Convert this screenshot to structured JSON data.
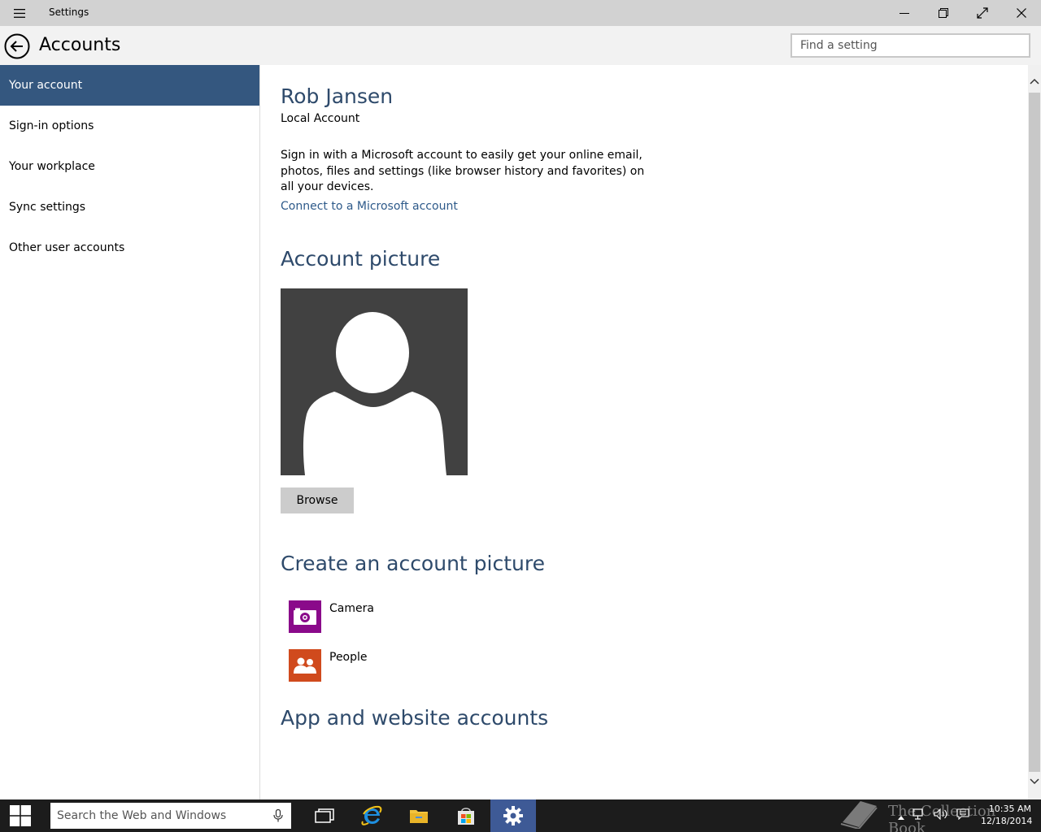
{
  "window": {
    "title": "Settings"
  },
  "header": {
    "title": "Accounts",
    "search_placeholder": "Find a setting"
  },
  "sidebar": {
    "items": [
      {
        "label": "Your account",
        "active": true
      },
      {
        "label": "Sign-in options",
        "active": false
      },
      {
        "label": "Your workplace",
        "active": false
      },
      {
        "label": "Sync settings",
        "active": false
      },
      {
        "label": "Other user accounts",
        "active": false
      }
    ]
  },
  "main": {
    "user_name": "Rob Jansen",
    "account_type": "Local Account",
    "description": "Sign in with a Microsoft account to easily get your online email, photos, files and settings (like browser history and favorites) on all your devices.",
    "connect_link": "Connect to a Microsoft account",
    "picture_heading": "Account picture",
    "browse_label": "Browse",
    "create_heading": "Create an account picture",
    "apps": [
      {
        "label": "Camera",
        "icon": "camera-icon",
        "color": "#8a0a8a"
      },
      {
        "label": "People",
        "icon": "people-icon",
        "color": "#d04a1d"
      }
    ],
    "app_accounts_heading": "App and website accounts"
  },
  "taskbar": {
    "search_placeholder": "Search the Web and Windows",
    "watermark": "The Collection Book",
    "clock_time": "10:35 AM",
    "clock_date": "12/18/2014",
    "active_app_color": "#3e5a96"
  },
  "colors": {
    "accent": "#34577f",
    "heading": "#2e4a6b",
    "link": "#2e5a8a"
  }
}
